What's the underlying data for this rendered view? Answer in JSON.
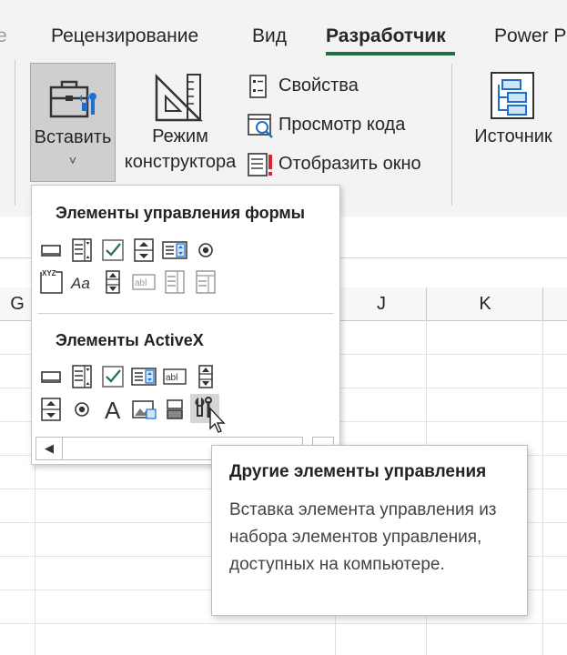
{
  "ribbon": {
    "tabs": [
      {
        "label": "e",
        "active": false
      },
      {
        "label": "Рецензирование",
        "active": false
      },
      {
        "label": "Вид",
        "active": false
      },
      {
        "label": "Разработчик",
        "active": true
      },
      {
        "label": "Power P",
        "active": false
      }
    ],
    "insert": {
      "label": "Вставить",
      "caret": "˅"
    },
    "design_mode": {
      "line1": "Режим",
      "line2": "конструктора"
    },
    "properties": "Свойства",
    "view_code": "Просмотр кода",
    "dialog": "Отобразить окно",
    "source": "Источник",
    "accent_color": "#1e7145"
  },
  "sheet": {
    "columns": [
      "G",
      "J",
      "K"
    ]
  },
  "dropdown": {
    "form_controls_title": "Элементы управления формы",
    "form_controls": [
      "button",
      "combo-box",
      "check-box",
      "spin-button",
      "list-box",
      "option-button",
      "group-box",
      "label",
      "scroll-bar",
      "text-field",
      "combo-list-edit",
      "combo-drop-down-edit"
    ],
    "activex_title": "Элементы ActiveX",
    "activex_controls": [
      "command-button",
      "combo-box",
      "check-box",
      "list-box",
      "text-box",
      "scroll-bar",
      "spin-button",
      "option-button",
      "label",
      "image",
      "toggle-button",
      "more-controls"
    ],
    "scroll_left": "◀"
  },
  "tooltip": {
    "title": "Другие элементы управления",
    "body": "Вставка элемента управления из набора элементов управления, доступных на компьютере."
  }
}
